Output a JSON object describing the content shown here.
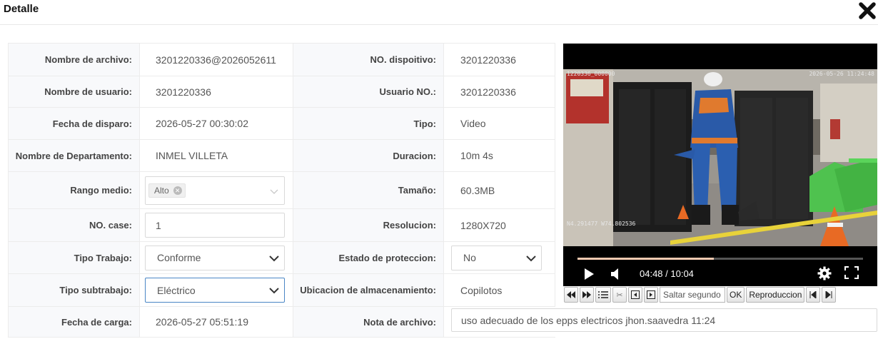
{
  "dialog": {
    "title": "Detalle",
    "close_icon": "close-x-icon"
  },
  "rows": {
    "r1": {
      "l1": "Nombre de archivo:",
      "v1": "3201220336@2026052611",
      "l2": "NO. dispoitivo:",
      "v2": "3201220336"
    },
    "r2": {
      "l1": "Nombre de usuario:",
      "v1": "3201220336",
      "l2": "Usuario NO.:",
      "v2": "3201220336"
    },
    "r3": {
      "l1": "Fecha de disparo:",
      "v1": "2026-05-27 00:30:02",
      "l2": "Tipo:",
      "v2": "Video"
    },
    "r4": {
      "l1": "Nombre de Departamento:",
      "v1": "INMEL VILLETA",
      "l2": "Duracion:",
      "v2": "10m 4s"
    },
    "r5": {
      "l1": "Rango medio:",
      "tag": "Alto",
      "l2": "Tamaño:",
      "v2": "60.3MB"
    },
    "r6": {
      "l1": "NO. case:",
      "input": "1",
      "l2": "Resolucion:",
      "v2": "1280X720"
    },
    "r7": {
      "l1": "Tipo Trabajo:",
      "select": "Conforme",
      "l2": "Estado de proteccion:",
      "select2": "No"
    },
    "r8": {
      "l1": "Tipo subtrabajo:",
      "select": "Eléctrico",
      "l2": "Ubicacion de almacenamiento:",
      "v2": "Copilotos"
    },
    "r9": {
      "l1": "Fecha de carga:",
      "v1": "2026-05-27 05:51:19",
      "l2": "Nota de archivo:",
      "note": "uso adecuado de los epps electricos jhon.saavedra 11:24"
    }
  },
  "player": {
    "osd_left": "1220336_000000",
    "osd_right": "2026-05-26 11:24:48",
    "osd_coords": "N4.291477 W74.802536",
    "time": "04:48 / 10:04",
    "progress": 0.477
  },
  "controls": {
    "search_placeholder": "Saltar segundo",
    "ok": "OK",
    "reproduccion": "Reproduccion"
  },
  "colors": {
    "accent": "#4a86c5",
    "progress": "#f2c9b0"
  }
}
